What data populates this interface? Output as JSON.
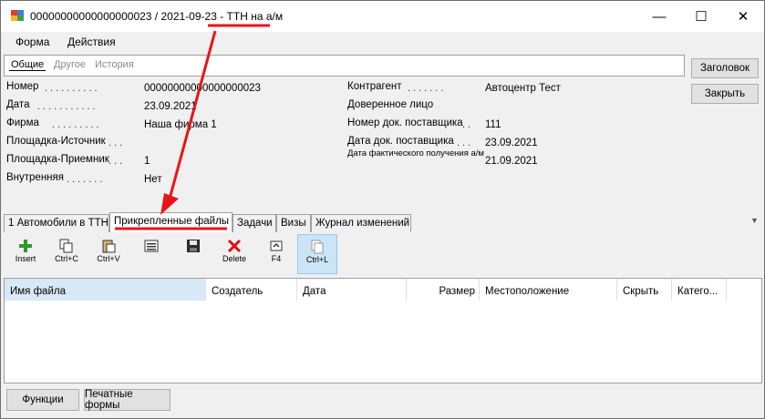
{
  "window": {
    "title_prefix": "00000000000000000023 / 2021-09-23 - ",
    "title_highlight": "ТТН на а/м",
    "controls": {
      "minimize": "—",
      "maximize": "☐",
      "close": "✕"
    }
  },
  "menu": [
    "Форма",
    "Действия"
  ],
  "header_tabs": [
    "Общие",
    "Другое",
    "История"
  ],
  "fields_left": [
    {
      "label": "Номер",
      "value": "00000000000000000023"
    },
    {
      "label": "Дата",
      "value": "23.09.2021"
    },
    {
      "label": "Фирма",
      "value": "Наша фирма 1"
    },
    {
      "label": "Площадка-Источник",
      "value": ""
    },
    {
      "label": "Площадка-Приемник",
      "value": "1"
    },
    {
      "label": "Внутренняя",
      "value": "Нет"
    }
  ],
  "fields_right": [
    {
      "label": "Контрагент",
      "value": "Автоцентр Тест"
    },
    {
      "label": "Доверенное лицо",
      "value": ""
    },
    {
      "label": "Номер док. поставщика",
      "value": "111"
    },
    {
      "label": "Дата док. поставщика",
      "value": "23.09.2021"
    },
    {
      "label": "Дата фактического получения а/м",
      "value": "21.09.2021"
    }
  ],
  "side_buttons": [
    "Заголовок",
    "Закрыть"
  ],
  "bottom_tabs": [
    {
      "label": "1 Автомобили в ТТН",
      "active": false
    },
    {
      "label": "Прикрепленные файлы",
      "active": true
    },
    {
      "label": "Задачи",
      "active": false
    },
    {
      "label": "Визы",
      "active": false
    },
    {
      "label": "Журнал изменений",
      "active": false
    }
  ],
  "toolbar": [
    {
      "icon": "plus-icon",
      "label": "Insert"
    },
    {
      "icon": "copy-icon",
      "label": "Ctrl+C"
    },
    {
      "icon": "paste-icon",
      "label": "Ctrl+V"
    },
    {
      "icon": "list-icon",
      "label": ""
    },
    {
      "icon": "save-icon",
      "label": ""
    },
    {
      "icon": "delete-icon",
      "label": "Delete"
    },
    {
      "icon": "refresh-icon",
      "label": "F4"
    },
    {
      "icon": "link-icon",
      "label": "Ctrl+L"
    }
  ],
  "grid_columns": [
    "Имя файла",
    "Создатель",
    "Дата",
    "Размер",
    "Местоположение",
    "Скрыть",
    "Катего..."
  ],
  "footer_buttons": [
    "Функции",
    "Печатные формы"
  ],
  "colors": {
    "annotation_red": "#e8141a",
    "selected_blue": "#cce4f7",
    "header_highlight": "#d9e8f7"
  }
}
